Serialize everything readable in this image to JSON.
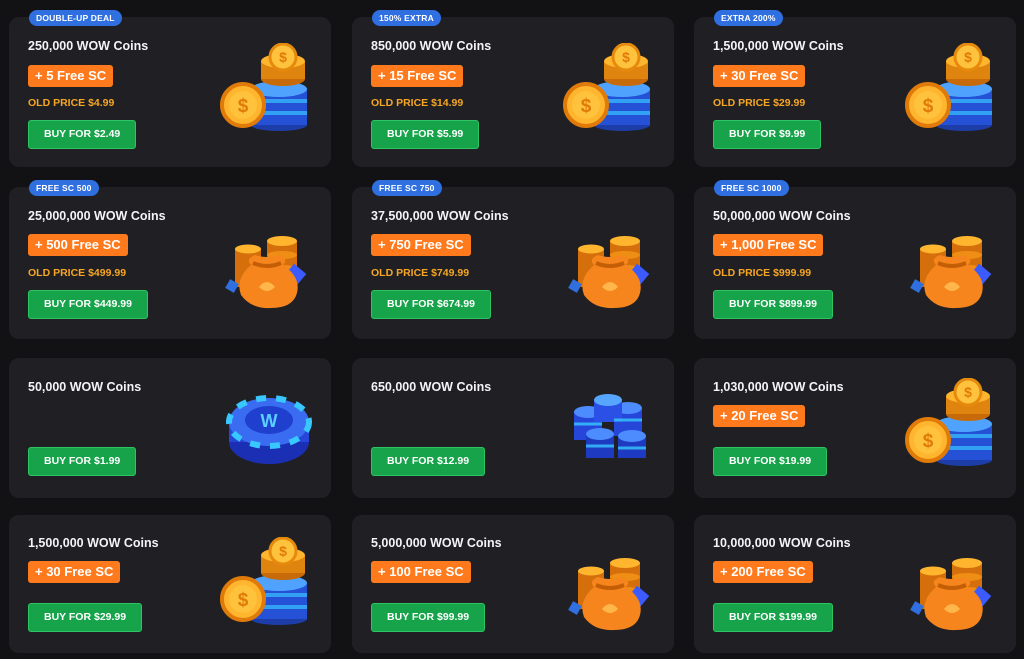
{
  "colors": {
    "background": "#121214",
    "card": "#202024",
    "badge": "#2f6fe0",
    "bonus": "#ff7a1c",
    "old_price": "#f6a623",
    "buy_button": "#16a34a"
  },
  "packages": [
    {
      "badge": "DOUBLE-UP DEAL",
      "title": "250,000 WOW Coins",
      "bonus": "+ 5 Free SC",
      "old_price": "OLD PRICE $4.99",
      "buy": "BUY FOR $2.49",
      "icon": "gold-coin-stack-icon"
    },
    {
      "badge": "150% EXTRA",
      "title": "850,000 WOW Coins",
      "bonus": "+ 15 Free SC",
      "old_price": "OLD PRICE $14.99",
      "buy": "BUY FOR $5.99",
      "icon": "gold-coin-stack-icon"
    },
    {
      "badge": "EXTRA 200%",
      "title": "1,500,000 WOW Coins",
      "bonus": "+ 30 Free SC",
      "old_price": "OLD PRICE $29.99",
      "buy": "BUY FOR $9.99",
      "icon": "gold-coin-stack-icon"
    },
    {
      "badge": "FREE SC 500",
      "title": "25,000,000 WOW Coins",
      "bonus": "+ 500 Free SC",
      "old_price": "OLD PRICE $499.99",
      "buy": "BUY FOR $449.99",
      "icon": "money-bag-icon"
    },
    {
      "badge": "FREE SC 750",
      "title": "37,500,000 WOW Coins",
      "bonus": "+ 750 Free SC",
      "old_price": "OLD PRICE $749.99",
      "buy": "BUY FOR $674.99",
      "icon": "money-bag-icon"
    },
    {
      "badge": "FREE SC 1000",
      "title": "50,000,000 WOW Coins",
      "bonus": "+ 1,000 Free SC",
      "old_price": "OLD PRICE $999.99",
      "buy": "BUY FOR $899.99",
      "icon": "money-bag-icon"
    },
    {
      "badge": "",
      "title": "50,000 WOW Coins",
      "bonus": "",
      "old_price": "",
      "buy": "BUY FOR $1.99",
      "icon": "wow-chip-icon"
    },
    {
      "badge": "",
      "title": "650,000 WOW Coins",
      "bonus": "",
      "old_price": "",
      "buy": "BUY FOR $12.99",
      "icon": "blue-chip-stacks-icon"
    },
    {
      "badge": "",
      "title": "1,030,000 WOW Coins",
      "bonus": "+ 20 Free SC",
      "old_price": "",
      "buy": "BUY FOR $19.99",
      "icon": "gold-coin-stack-icon"
    },
    {
      "badge": "",
      "title": "1,500,000 WOW Coins",
      "bonus": "+ 30 Free SC",
      "old_price": "",
      "buy": "BUY FOR $29.99",
      "icon": "gold-coin-stack-icon"
    },
    {
      "badge": "",
      "title": "5,000,000 WOW Coins",
      "bonus": "+ 100 Free SC",
      "old_price": "",
      "buy": "BUY FOR $99.99",
      "icon": "money-bag-icon"
    },
    {
      "badge": "",
      "title": "10,000,000 WOW Coins",
      "bonus": "+ 200 Free SC",
      "old_price": "",
      "buy": "BUY FOR $199.99",
      "icon": "money-bag-icon"
    }
  ]
}
